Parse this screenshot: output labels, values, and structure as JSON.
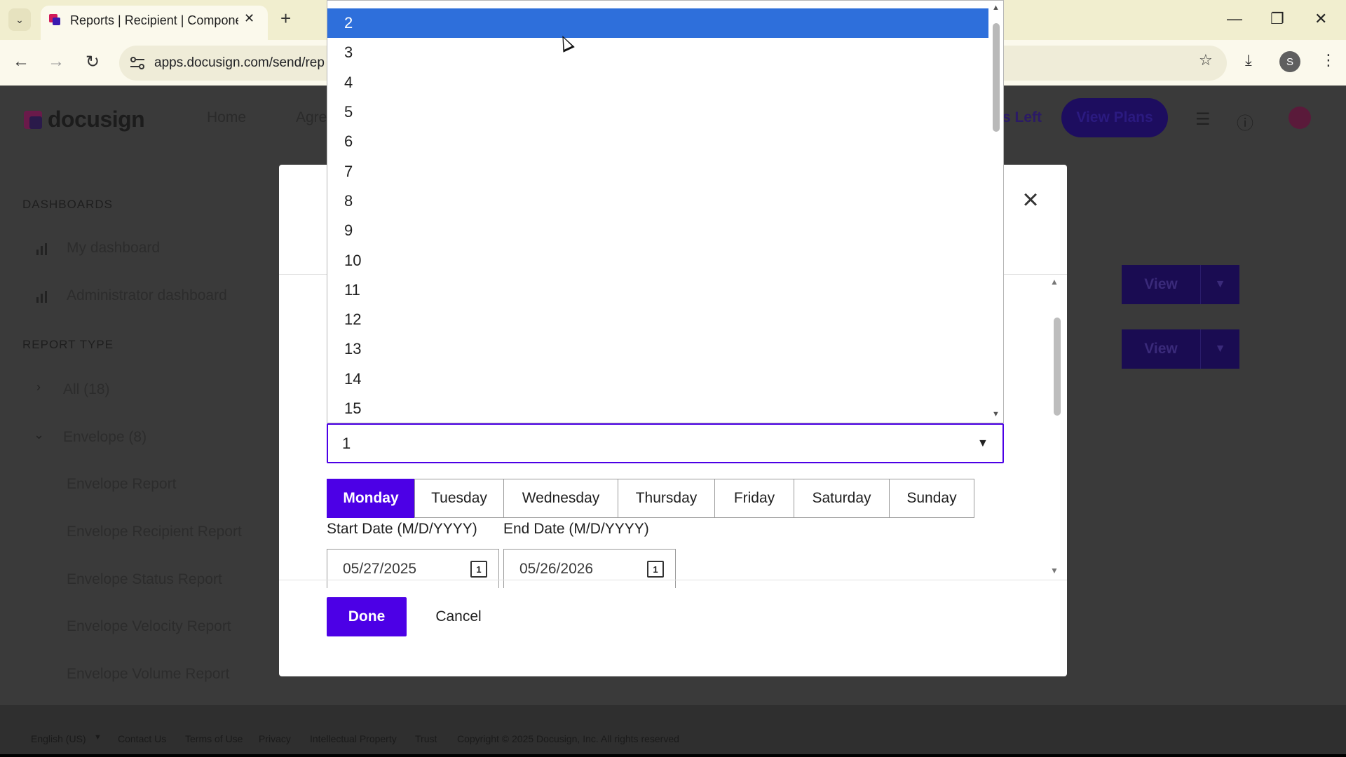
{
  "browser": {
    "tab_title": "Reports | Recipient | Componen",
    "url": "apps.docusign.com/send/rep",
    "profile_initial": "S"
  },
  "header": {
    "logo": "docusign",
    "nav": [
      "Home",
      "Agre"
    ],
    "envelopes_left": "s Left",
    "view_plans": "View Plans"
  },
  "sidebar": {
    "dashboards_heading": "DASHBOARDS",
    "dashboards": [
      "My dashboard",
      "Administrator dashboard"
    ],
    "report_type_heading": "REPORT TYPE",
    "groups": [
      "All (18)",
      "Envelope (8)"
    ],
    "reports": [
      "Envelope Report",
      "Envelope Recipient Report",
      "Envelope Status Report",
      "Envelope Velocity Report",
      "Envelope Volume Report"
    ]
  },
  "main": {
    "view_label": "View"
  },
  "footer": {
    "links": [
      "English (US)",
      "Contact Us",
      "Terms of Use",
      "Privacy",
      "Intellectual Property",
      "Trust",
      "Copyright © 2025 Docusign, Inc. All rights reserved"
    ]
  },
  "modal": {
    "select_value": "1",
    "dropdown_options": [
      "2",
      "3",
      "4",
      "5",
      "6",
      "7",
      "8",
      "9",
      "10",
      "11",
      "12",
      "13",
      "14",
      "15"
    ],
    "highlighted_option": "2",
    "days": [
      "Monday",
      "Tuesday",
      "Wednesday",
      "Thursday",
      "Friday",
      "Saturday",
      "Sunday"
    ],
    "active_day": "Monday",
    "start_date_label": "Start Date (M/D/YYYY)",
    "end_date_label": "End Date (M/D/YYYY)",
    "start_date": "05/27/2025",
    "end_date": "05/26/2026",
    "calendar_glyph": "1",
    "done_label": "Done",
    "cancel_label": "Cancel"
  },
  "colors": {
    "accent": "#4c00e6",
    "option_highlight": "#2e6fdb",
    "overlay_page": "#3a3a3a"
  }
}
